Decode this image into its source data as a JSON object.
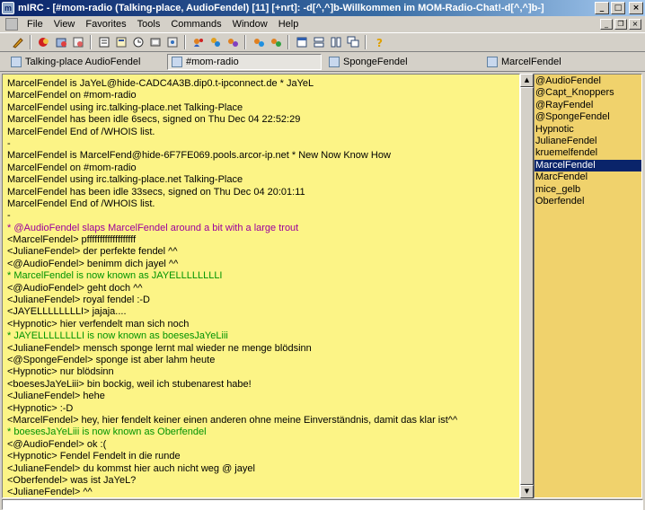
{
  "window": {
    "title": "mIRC - [#mom-radio (Talking-place, AudioFendel) [11] [+nrt]: -d[^,^]b-Willkommen im MOM-Radio-Chat!-d[^,^]b-]",
    "icon": "mirc-icon",
    "minimize": "_",
    "maximize": "□",
    "close": "×"
  },
  "menu": {
    "items": [
      "File",
      "View",
      "Favorites",
      "Tools",
      "Commands",
      "Window",
      "Help"
    ],
    "mdi_minimize": "_",
    "mdi_restore": "❐",
    "mdi_close": "×"
  },
  "toolbar": {
    "buttons": [
      "connect-icon",
      "disconnect-icon",
      "options-icon",
      "favorites-icon",
      "channels-icon",
      "address-book-icon",
      "scripts-editor-icon",
      "dcc-send-icon",
      "dcc-chat-icon",
      "finger-icon",
      "notify-list-icon",
      "url-list-icon",
      "ignore-list-icon",
      "dcc-options-icon",
      "log-icon",
      "colors-icon",
      "tile-horizontal-icon",
      "tile-vertical-icon",
      "cascade-icon",
      "help-icon"
    ]
  },
  "switchbar": {
    "tabs": [
      {
        "label": "Talking-place AudioFendel",
        "active": false
      },
      {
        "label": "#mom-radio",
        "active": true
      },
      {
        "label": "SpongeFendel",
        "active": false
      },
      {
        "label": "MarcelFendel",
        "active": false
      }
    ]
  },
  "chat": {
    "lines": [
      {
        "text": "MarcelFendel is JaYeL@hide-CADC4A3B.dip0.t-ipconnect.de * JaYeL",
        "type": "normal"
      },
      {
        "text": "MarcelFendel on #mom-radio",
        "type": "normal"
      },
      {
        "text": "MarcelFendel using irc.talking-place.net Talking-Place",
        "type": "normal"
      },
      {
        "text": "MarcelFendel has been idle 6secs, signed on Thu Dec 04 22:52:29",
        "type": "normal"
      },
      {
        "text": "MarcelFendel End of /WHOIS list.",
        "type": "normal"
      },
      {
        "text": "-",
        "type": "normal"
      },
      {
        "text": "MarcelFendel is MarcelFend@hide-6F7FE069.pools.arcor-ip.net * New Now Know How",
        "type": "normal"
      },
      {
        "text": "MarcelFendel on #mom-radio",
        "type": "normal"
      },
      {
        "text": "MarcelFendel using irc.talking-place.net Talking-Place",
        "type": "normal"
      },
      {
        "text": "MarcelFendel has been idle 33secs, signed on Thu Dec 04 20:01:11",
        "type": "normal"
      },
      {
        "text": "MarcelFendel End of /WHOIS list.",
        "type": "normal"
      },
      {
        "text": "-",
        "type": "normal"
      },
      {
        "text": "* @AudioFendel slaps MarcelFendel around a bit with a large trout",
        "type": "action"
      },
      {
        "text": "<MarcelFendel> pfffffffffffffffffff",
        "type": "normal"
      },
      {
        "text": "<JulianeFendel> der perfekte fendel ^^",
        "type": "normal"
      },
      {
        "text": "<@AudioFendel> benimm dich jayel ^^",
        "type": "normal"
      },
      {
        "text": "* MarcelFendel is now known as JAYELLLLLLLLI",
        "type": "nick"
      },
      {
        "text": "<@AudioFendel> geht doch ^^",
        "type": "normal"
      },
      {
        "text": "<JulianeFendel> royal fendel :-D",
        "type": "normal"
      },
      {
        "text": "<JAYELLLLLLLLI> jajaja....",
        "type": "normal"
      },
      {
        "text": "<Hypnotic> hier verfendelt man sich noch",
        "type": "normal"
      },
      {
        "text": "* JAYELLLLLLLLI is now known as boesesJaYeLiii",
        "type": "nick"
      },
      {
        "text": "<JulianeFendel> mensch sponge lernt mal wieder ne menge blödsinn",
        "type": "normal"
      },
      {
        "text": "<@SpongeFendel> sponge ist aber lahm heute",
        "type": "normal"
      },
      {
        "text": "<Hypnotic> nur blödsinn",
        "type": "normal"
      },
      {
        "text": "<boesesJaYeLiii> bin bockig, weil ich stubenarest habe!",
        "type": "normal"
      },
      {
        "text": "<JulianeFendel> hehe",
        "type": "normal"
      },
      {
        "text": "<Hypnotic> :-D",
        "type": "normal"
      },
      {
        "text": "<MarcelFendel> hey, hier fendelt keiner einen anderen ohne meine Einverständnis, damit das klar ist^^",
        "type": "normal"
      },
      {
        "text": "* boesesJaYeLiii is now known as Oberfendel",
        "type": "nick"
      },
      {
        "text": "<@AudioFendel> ok :(",
        "type": "normal"
      },
      {
        "text": "<Hypnotic> Fendel Fendelt in die runde",
        "type": "normal"
      },
      {
        "text": "<JulianeFendel> du kommst hier auch nicht weg @ jayel",
        "type": "normal"
      },
      {
        "text": "<Oberfendel> was ist JaYeL?",
        "type": "normal"
      },
      {
        "text": "<JulianeFendel> ^^",
        "type": "normal"
      }
    ]
  },
  "nicklist": {
    "nicks": [
      {
        "name": "@AudioFendel",
        "selected": false
      },
      {
        "name": "@Capt_Knoppers",
        "selected": false
      },
      {
        "name": "@RayFendel",
        "selected": false
      },
      {
        "name": "@SpongeFendel",
        "selected": false
      },
      {
        "name": "Hypnotic",
        "selected": false
      },
      {
        "name": "JulianeFendel",
        "selected": false
      },
      {
        "name": "kruemelfendel",
        "selected": false
      },
      {
        "name": "MarcelFendel",
        "selected": true
      },
      {
        "name": "MarcFendel",
        "selected": false
      },
      {
        "name": "mice_gelb",
        "selected": false
      },
      {
        "name": "Oberfendel",
        "selected": false
      }
    ]
  },
  "colors": {
    "chat_bg": "#fcf486",
    "nicklist_bg": "#f0d26c",
    "action": "#9c009c",
    "nick_change": "#009300",
    "selection": "#0a246a"
  },
  "input": {
    "value": ""
  }
}
